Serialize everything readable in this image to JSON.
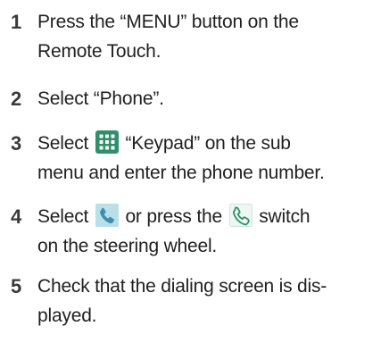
{
  "steps": [
    {
      "number": "1",
      "lines": [
        "Press the “MENU” button on the",
        "Remote Touch."
      ]
    },
    {
      "number": "2",
      "lines": [
        "Select “Phone”."
      ]
    },
    {
      "number": "3",
      "line1_before": "Select",
      "line1_after": "“Keypad” on the sub",
      "line2": "menu and enter the phone number.",
      "icon": "keypad-grid-icon"
    },
    {
      "number": "4",
      "line1_before": "Select",
      "line1_middle": "or press the",
      "line1_after": "switch",
      "line2": "on the steering wheel.",
      "icon1": "phone-handset-screen-icon",
      "icon2": "phone-handset-switch-icon"
    },
    {
      "number": "5",
      "lines": [
        "Check that the dialing screen is dis-",
        "played."
      ]
    }
  ],
  "colors": {
    "text": "#1f1f1f",
    "number": "#3a3a3a",
    "icon_green": "#2f8f6a",
    "icon_bg": "#b9dfe9"
  }
}
